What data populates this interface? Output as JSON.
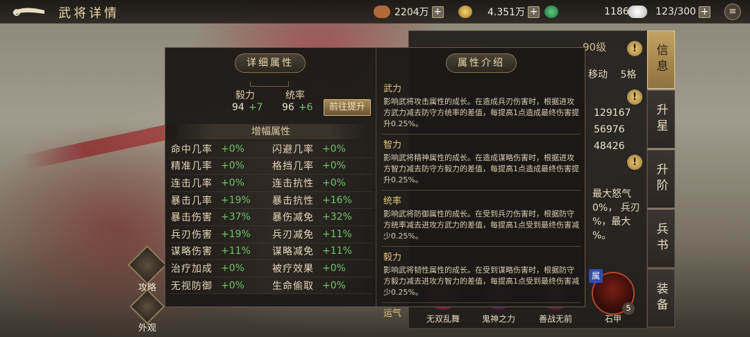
{
  "header": {
    "title": "武将详情",
    "resources": [
      {
        "icon": "bronze-coin-icon",
        "value": "2204万",
        "color": "#b06a3a"
      },
      {
        "icon": "gold-coin-icon",
        "value": "4.351万",
        "color": "#d8b24a"
      },
      {
        "icon": "jade-icon",
        "value": "1186",
        "color": "#3a9a58"
      },
      {
        "icon": "stamina-icon",
        "value": "123/300",
        "color": "#e6e6e6"
      }
    ],
    "plus": "+",
    "menu_icon": "≡"
  },
  "side_tabs": [
    "信息",
    "升星",
    "升阶",
    "兵书",
    "装备"
  ],
  "info_panel": {
    "header": "90级",
    "move_label": "移动",
    "move_value": "5格",
    "stats": [
      "129167",
      "56976",
      "48426"
    ],
    "warn": "!",
    "rage_lines": [
      "最大怒气",
      "0%， 兵刃",
      "%，最大",
      "%。"
    ]
  },
  "skills": [
    {
      "name": "无双乱舞",
      "color": "#b5335d"
    },
    {
      "name": "鬼神之力",
      "color": "#7a2c74"
    },
    {
      "name": "善战无前",
      "color": "#8a3a5a"
    },
    {
      "name": "石甲",
      "tag": "属",
      "level": "5"
    }
  ],
  "quick_buttons": [
    {
      "icon": "strategy-scroll-icon",
      "label": "攻略"
    },
    {
      "icon": "appearance-armor-icon",
      "label": "外观"
    }
  ],
  "popup": {
    "left_title": "详细属性",
    "right_title": "属性介绍",
    "props": [
      {
        "name": "毅力",
        "base": "94",
        "bonus": "+7"
      },
      {
        "name": "统率",
        "base": "96",
        "bonus": "+6"
      }
    ],
    "goto_button": "前往提升",
    "amplify_title": "增幅属性",
    "attrs": [
      [
        "命中几率",
        "+0%",
        "闪避几率",
        "+0%"
      ],
      [
        "精准几率",
        "+0%",
        "格挡几率",
        "+0%"
      ],
      [
        "连击几率",
        "+0%",
        "连击抗性",
        "+0%"
      ],
      [
        "暴击几率",
        "+19%",
        "暴击抗性",
        "+16%"
      ],
      [
        "暴击伤害",
        "+37%",
        "暴伤减免",
        "+32%"
      ],
      [
        "兵刃伤害",
        "+19%",
        "兵刃减免",
        "+11%"
      ],
      [
        "谋略伤害",
        "+11%",
        "谋略减免",
        "+11%"
      ],
      [
        "治疗加成",
        "+0%",
        "被疗效果",
        "+0%"
      ],
      [
        "无视防御",
        "+0%",
        "生命偷取",
        "+0%"
      ]
    ],
    "descriptions": [
      {
        "title": "武力",
        "text": "影响武将攻击属性的成长。在造成兵刃伤害时，根据进攻方武力减去防守方统率的差值，每提高1点造成最终伤害提升0.25%。"
      },
      {
        "title": "智力",
        "text": "影响武将精神属性的成长。在造成谋略伤害时，根据进攻方智力减去防守方毅力的差值，每提高1点造成最终伤害提升0.25%。"
      },
      {
        "title": "统率",
        "text": "影响武将防御属性的成长。在受到兵刃伤害时，根据防守方统率减去进攻方武力的差值，每提高1点受到最终伤害减少0.25%。"
      },
      {
        "title": "毅力",
        "text": "影响武将韧性属性的成长。在受到谋略伤害时，根据防守方毅力减去进攻方智力的差值，每提高1点受到最终伤害减少0.25%。"
      },
      {
        "title": "运气",
        "text": ""
      }
    ]
  }
}
